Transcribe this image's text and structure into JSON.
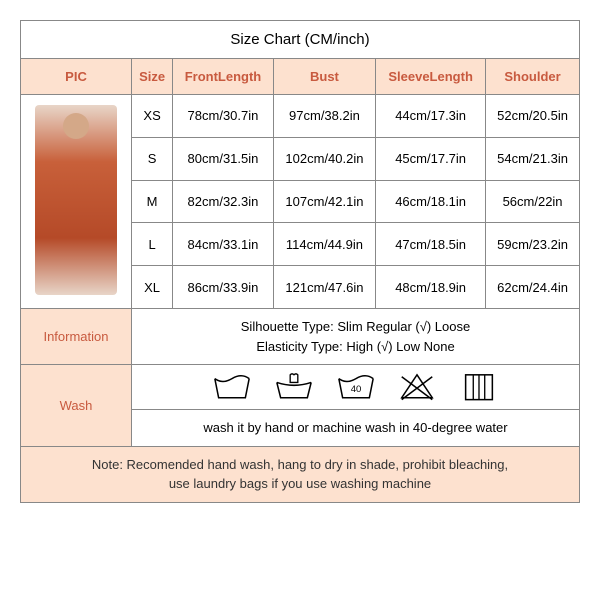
{
  "title": "Size Chart  (CM/inch)",
  "headers": {
    "pic": "PIC",
    "size": "Size",
    "frontLength": "FrontLength",
    "bust": "Bust",
    "sleeveLength": "SleeveLength",
    "shoulder": "Shoulder"
  },
  "rows": [
    {
      "size": "XS",
      "front": "78cm/30.7in",
      "bust": "97cm/38.2in",
      "sleeve": "44cm/17.3in",
      "shoulder": "52cm/20.5in"
    },
    {
      "size": "S",
      "front": "80cm/31.5in",
      "bust": "102cm/40.2in",
      "sleeve": "45cm/17.7in",
      "shoulder": "54cm/21.3in"
    },
    {
      "size": "M",
      "front": "82cm/32.3in",
      "bust": "107cm/42.1in",
      "sleeve": "46cm/18.1in",
      "shoulder": "56cm/22in"
    },
    {
      "size": "L",
      "front": "84cm/33.1in",
      "bust": "114cm/44.9in",
      "sleeve": "47cm/18.5in",
      "shoulder": "59cm/23.2in"
    },
    {
      "size": "XL",
      "front": "86cm/33.9in",
      "bust": "121cm/47.6in",
      "sleeve": "48cm/18.9in",
      "shoulder": "62cm/24.4in"
    }
  ],
  "labels": {
    "information": "Information",
    "wash": "Wash"
  },
  "info": {
    "line1": "Silhouette Type: Slim  Regular (√)  Loose",
    "line2": "Elasticity Type: High (√)  Low  None"
  },
  "washText": "wash it by hand or machine wash in 40-degree water",
  "note": {
    "line1": "Note: Recomended hand wash, hang to dry in shade, prohibit bleaching,",
    "line2": "use laundry bags if you use washing machine"
  },
  "washIconLabel": "40"
}
